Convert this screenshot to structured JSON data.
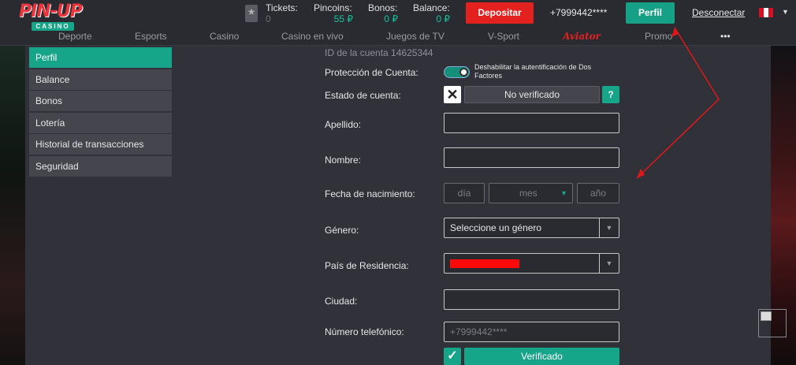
{
  "header": {
    "logo_main": "PIN-UP",
    "logo_sub": "CASINO",
    "stats": [
      {
        "label": "Tickets:",
        "value": "0"
      },
      {
        "label": "Pincoins:",
        "value": "55 ₽"
      },
      {
        "label": "Bonos:",
        "value": "0 ₽"
      },
      {
        "label": "Balance:",
        "value": "0 ₽"
      }
    ],
    "deposit_label": "Depositar",
    "phone": "+7999442****",
    "profile_label": "Perfil",
    "logout_label": "Desconectar",
    "flag_colors": [
      "#d91023",
      "#ffffff",
      "#d91023"
    ]
  },
  "nav": {
    "items": [
      "Deporte",
      "Esports",
      "Casino",
      "Casino en vivo",
      "Juegos de TV",
      "V-Sport",
      "Aviator",
      "Promo",
      "•••"
    ]
  },
  "sidebar": {
    "items": [
      "Perfil",
      "Balance",
      "Bonos",
      "Lotería",
      "Historial de transacciones",
      "Seguridad"
    ]
  },
  "form": {
    "account_id": "ID de la cuenta 14625344",
    "protection_label": "Protección de Cuenta:",
    "two_factor_text": "Deshabilitar la autentificación de Dos Factores",
    "status_label": "Estado de cuenta:",
    "status_value": "No verificado",
    "help_label": "?",
    "surname_label": "Apellido:",
    "name_label": "Nombre:",
    "birth_label": "Fecha de nacimiento:",
    "day_placeholder": "día",
    "month_placeholder": "mes",
    "year_placeholder": "año",
    "gender_label": "Género:",
    "gender_value": "Seleccione un género",
    "country_label": "País de Residencia:",
    "city_label": "Ciudad:",
    "phone_label": "Número telefónico:",
    "phone_value": "+7999442****",
    "verified_label": "Verificado"
  },
  "colors": {
    "accent": "#17a589",
    "danger": "#e32220",
    "annotation_arrow": "#e01818"
  }
}
